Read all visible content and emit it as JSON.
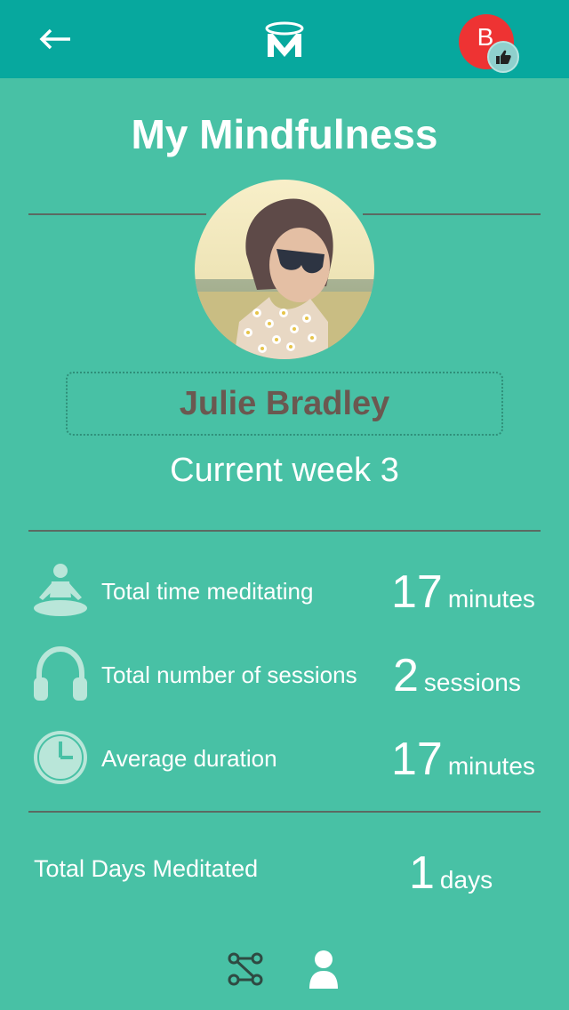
{
  "header": {
    "back_icon": "arrow-left-icon",
    "logo_icon": "m-halo-logo",
    "user_initial": "B",
    "user_badge_icon": "thumbs-up-icon",
    "badge_color": "#ee3333"
  },
  "page": {
    "title": "My Mindfulness",
    "user_name": "Julie Bradley",
    "current_week": "Current week 3"
  },
  "stats": [
    {
      "icon": "meditation-pose-icon",
      "label": "Total time meditating",
      "value": "17",
      "unit": "minutes"
    },
    {
      "icon": "headphones-icon",
      "label": "Total number of sessions",
      "value": "2",
      "unit": "sessions"
    },
    {
      "icon": "clock-icon",
      "label": "Average duration",
      "value": "17",
      "unit": "minutes"
    }
  ],
  "total_days": {
    "label": "Total Days Meditated",
    "value": "1",
    "unit": "days"
  },
  "bottom_nav": [
    {
      "icon": "network-nodes-icon"
    },
    {
      "icon": "person-icon"
    }
  ],
  "colors": {
    "background": "#48c1a5",
    "header": "#07a89e",
    "icon_tint": "#b9e6d9",
    "name_text": "#6b5850"
  }
}
